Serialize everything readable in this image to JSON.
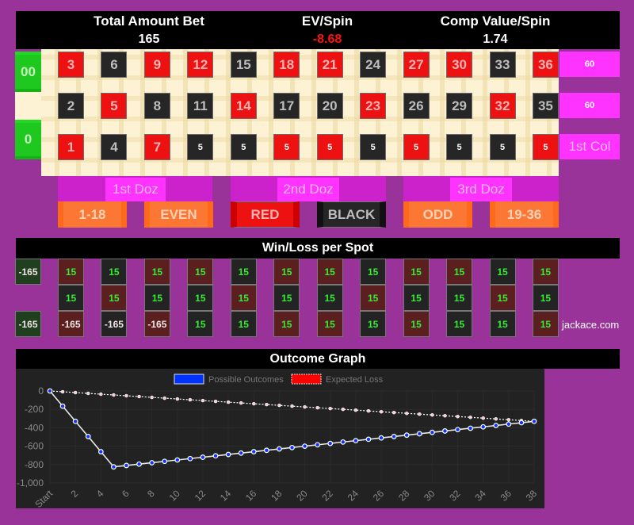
{
  "stats": {
    "total_bet_label": "Total Amount Bet",
    "total_bet_value": "165",
    "ev_label": "EV/Spin",
    "ev_value": "-8.68",
    "comp_label": "Comp Value/Spin",
    "comp_value": "1.74",
    "ev_color": "#ff1111"
  },
  "table": {
    "zeros": [
      "00",
      "0"
    ],
    "rows": [
      [
        {
          "t": "3",
          "c": "red"
        },
        {
          "t": "6",
          "c": "black"
        },
        {
          "t": "9",
          "c": "red"
        },
        {
          "t": "12",
          "c": "red"
        },
        {
          "t": "15",
          "c": "black"
        },
        {
          "t": "18",
          "c": "red"
        },
        {
          "t": "21",
          "c": "red"
        },
        {
          "t": "24",
          "c": "black"
        },
        {
          "t": "27",
          "c": "red"
        },
        {
          "t": "30",
          "c": "red"
        },
        {
          "t": "33",
          "c": "black"
        },
        {
          "t": "36",
          "c": "red"
        }
      ],
      [
        {
          "t": "2",
          "c": "black"
        },
        {
          "t": "5",
          "c": "red"
        },
        {
          "t": "8",
          "c": "black"
        },
        {
          "t": "11",
          "c": "black"
        },
        {
          "t": "14",
          "c": "red"
        },
        {
          "t": "17",
          "c": "black"
        },
        {
          "t": "20",
          "c": "black"
        },
        {
          "t": "23",
          "c": "red"
        },
        {
          "t": "26",
          "c": "black"
        },
        {
          "t": "29",
          "c": "black"
        },
        {
          "t": "32",
          "c": "red"
        },
        {
          "t": "35",
          "c": "black"
        }
      ],
      [
        {
          "t": "1",
          "c": "red"
        },
        {
          "t": "4",
          "c": "black"
        },
        {
          "t": "7",
          "c": "red"
        },
        {
          "t": "5",
          "c": "black",
          "chip": true
        },
        {
          "t": "5",
          "c": "black",
          "chip": true
        },
        {
          "t": "5",
          "c": "red",
          "chip": true
        },
        {
          "t": "5",
          "c": "red",
          "chip": true
        },
        {
          "t": "5",
          "c": "black",
          "chip": true
        },
        {
          "t": "5",
          "c": "red",
          "chip": true
        },
        {
          "t": "5",
          "c": "black",
          "chip": true
        },
        {
          "t": "5",
          "c": "black",
          "chip": true
        },
        {
          "t": "5",
          "c": "red",
          "chip": true
        }
      ]
    ],
    "columns": [
      {
        "text": "60",
        "is_chip": true
      },
      {
        "text": "60",
        "is_chip": true
      },
      {
        "text": "1st Col",
        "is_chip": false
      }
    ],
    "dozens": [
      "1st Doz",
      "2nd Doz",
      "3rd Doz"
    ],
    "outside": [
      {
        "label": "1-18",
        "style": "orange"
      },
      {
        "label": "EVEN",
        "style": "orange"
      },
      {
        "label": "RED",
        "style": "redb"
      },
      {
        "label": "BLACK",
        "style": "blackb"
      },
      {
        "label": "ODD",
        "style": "orange"
      },
      {
        "label": "19-36",
        "style": "orange"
      }
    ]
  },
  "winloss": {
    "title": "Win/Loss per Spot",
    "zeros": [
      "-165",
      "-165"
    ],
    "rows": [
      [
        {
          "v": "15",
          "c": "r"
        },
        {
          "v": "15",
          "c": "b"
        },
        {
          "v": "15",
          "c": "r"
        },
        {
          "v": "15",
          "c": "r"
        },
        {
          "v": "15",
          "c": "b"
        },
        {
          "v": "15",
          "c": "r"
        },
        {
          "v": "15",
          "c": "r"
        },
        {
          "v": "15",
          "c": "b"
        },
        {
          "v": "15",
          "c": "r"
        },
        {
          "v": "15",
          "c": "r"
        },
        {
          "v": "15",
          "c": "b"
        },
        {
          "v": "15",
          "c": "r"
        }
      ],
      [
        {
          "v": "15",
          "c": "b"
        },
        {
          "v": "15",
          "c": "r"
        },
        {
          "v": "15",
          "c": "b"
        },
        {
          "v": "15",
          "c": "b"
        },
        {
          "v": "15",
          "c": "r"
        },
        {
          "v": "15",
          "c": "b"
        },
        {
          "v": "15",
          "c": "b"
        },
        {
          "v": "15",
          "c": "r"
        },
        {
          "v": "15",
          "c": "b"
        },
        {
          "v": "15",
          "c": "b"
        },
        {
          "v": "15",
          "c": "r"
        },
        {
          "v": "15",
          "c": "b"
        }
      ],
      [
        {
          "v": "-165",
          "c": "r"
        },
        {
          "v": "-165",
          "c": "b"
        },
        {
          "v": "-165",
          "c": "r"
        },
        {
          "v": "15",
          "c": "b"
        },
        {
          "v": "15",
          "c": "b"
        },
        {
          "v": "15",
          "c": "r"
        },
        {
          "v": "15",
          "c": "r"
        },
        {
          "v": "15",
          "c": "b"
        },
        {
          "v": "15",
          "c": "r"
        },
        {
          "v": "15",
          "c": "b"
        },
        {
          "v": "15",
          "c": "b"
        },
        {
          "v": "15",
          "c": "r"
        }
      ]
    ],
    "brand": "jackace.com"
  },
  "graph": {
    "title": "Outcome Graph"
  },
  "chart_data": {
    "type": "line",
    "title": "Outcome Graph",
    "xlabel": "",
    "ylabel": "",
    "x": [
      "Start",
      1,
      2,
      3,
      4,
      5,
      6,
      7,
      8,
      9,
      10,
      11,
      12,
      13,
      14,
      15,
      16,
      17,
      18,
      19,
      20,
      21,
      22,
      23,
      24,
      25,
      26,
      27,
      28,
      29,
      30,
      31,
      32,
      33,
      34,
      35,
      36,
      37,
      38
    ],
    "x_tick_labels": [
      "Start",
      "2",
      "4",
      "6",
      "8",
      "10",
      "12",
      "14",
      "16",
      "18",
      "20",
      "22",
      "24",
      "26",
      "28",
      "30",
      "32",
      "34",
      "36",
      "38"
    ],
    "y_tick_labels": [
      "0",
      "-200",
      "-400",
      "-600",
      "-800",
      "-1,000"
    ],
    "ylim": [
      -1000,
      0
    ],
    "grid": true,
    "legend_position": "top-center",
    "series": [
      {
        "name": "Possible Outcomes",
        "color": "#0033ff",
        "line_color": "#ffffff",
        "dashed": false,
        "values": [
          0,
          -165,
          -330,
          -495,
          -660,
          -825,
          -810,
          -795,
          -780,
          -765,
          -750,
          -735,
          -720,
          -705,
          -690,
          -675,
          -660,
          -645,
          -630,
          -615,
          -600,
          -585,
          -570,
          -555,
          -540,
          -525,
          -510,
          -495,
          -480,
          -465,
          -450,
          -435,
          -420,
          -405,
          -390,
          -375,
          -360,
          -345,
          -330
        ]
      },
      {
        "name": "Expected Loss",
        "color": "#ff0000",
        "line_color": "#ffffff",
        "dashed": true,
        "values": [
          0,
          -8.68,
          -17.37,
          -26.05,
          -34.74,
          -43.42,
          -52.11,
          -60.79,
          -69.47,
          -78.16,
          -86.84,
          -95.53,
          -104.21,
          -112.89,
          -121.58,
          -130.26,
          -138.95,
          -147.63,
          -156.32,
          -165,
          -173.68,
          -182.37,
          -191.05,
          -199.74,
          -208.42,
          -217.11,
          -225.79,
          -234.47,
          -243.16,
          -251.84,
          -260.53,
          -269.21,
          -277.89,
          -286.58,
          -295.26,
          -303.95,
          -312.63,
          -321.32,
          -330
        ]
      }
    ]
  }
}
